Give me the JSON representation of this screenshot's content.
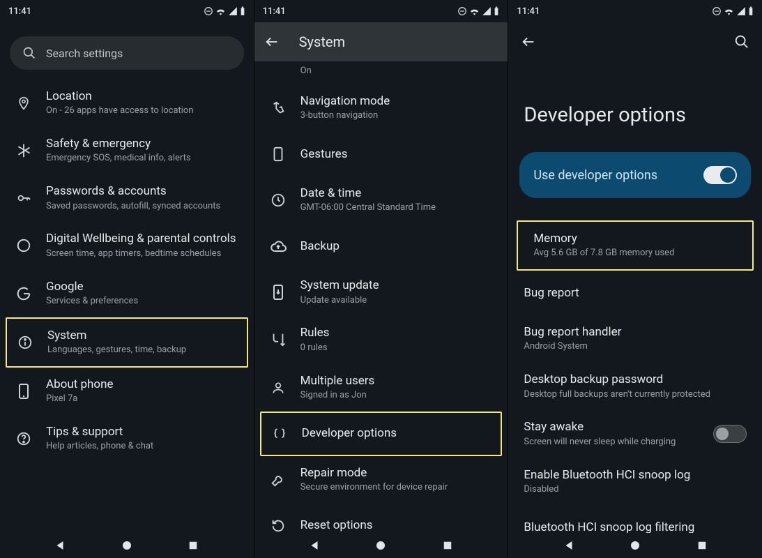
{
  "status": {
    "time": "11:41"
  },
  "screen1": {
    "search_placeholder": "Search settings",
    "items": [
      {
        "name": "location",
        "icon": "pin",
        "title": "Location",
        "subtitle": "On - 26 apps have access to location"
      },
      {
        "name": "safety",
        "icon": "asterisk",
        "title": "Safety & emergency",
        "subtitle": "Emergency SOS, medical info, alerts"
      },
      {
        "name": "passwords",
        "icon": "key",
        "title": "Passwords & accounts",
        "subtitle": "Saved passwords, autofill, synced accounts"
      },
      {
        "name": "wellbeing",
        "icon": "wellbeing",
        "title": "Digital Wellbeing & parental controls",
        "subtitle": "Screen time, app timers, bedtime schedules"
      },
      {
        "name": "google",
        "icon": "google",
        "title": "Google",
        "subtitle": "Services & preferences"
      },
      {
        "name": "system",
        "icon": "info",
        "title": "System",
        "subtitle": "Languages, gestures, time, backup",
        "highlight": true
      },
      {
        "name": "about",
        "icon": "phone",
        "title": "About phone",
        "subtitle": "Pixel 7a"
      },
      {
        "name": "tips",
        "icon": "help",
        "title": "Tips & support",
        "subtitle": "Help articles, phone & chat"
      }
    ]
  },
  "screen2": {
    "title": "System",
    "peek_subtitle": "On",
    "items": [
      {
        "name": "navmode",
        "icon": "swipe",
        "title": "Navigation mode",
        "subtitle": "3-button navigation"
      },
      {
        "name": "gestures",
        "icon": "phone-rect",
        "title": "Gestures"
      },
      {
        "name": "datetime",
        "icon": "clock",
        "title": "Date & time",
        "subtitle": "GMT-06:00 Central Standard Time"
      },
      {
        "name": "backup",
        "icon": "cloud",
        "title": "Backup"
      },
      {
        "name": "update",
        "icon": "phone-down",
        "title": "System update",
        "subtitle": "Update available"
      },
      {
        "name": "rules",
        "icon": "rules",
        "title": "Rules",
        "subtitle": "0 rules"
      },
      {
        "name": "users",
        "icon": "user",
        "title": "Multiple users",
        "subtitle": "Signed in as Jon"
      },
      {
        "name": "devopts",
        "icon": "braces",
        "title": "Developer options",
        "highlight": true
      },
      {
        "name": "repair",
        "icon": "wrench",
        "title": "Repair mode",
        "subtitle": "Secure environment for device repair"
      },
      {
        "name": "reset",
        "icon": "reset",
        "title": "Reset options"
      }
    ]
  },
  "screen3": {
    "title": "Developer options",
    "toggle_label": "Use developer options",
    "toggle_on": true,
    "items": [
      {
        "name": "memory",
        "title": "Memory",
        "subtitle": "Avg 5.6 GB of 7.8 GB memory used",
        "highlight": true
      },
      {
        "name": "bugreport",
        "title": "Bug report"
      },
      {
        "name": "bughandler",
        "title": "Bug report handler",
        "subtitle": "Android System"
      },
      {
        "name": "desktop-backup",
        "title": "Desktop backup password",
        "subtitle": "Desktop full backups aren't currently protected"
      },
      {
        "name": "stay-awake",
        "title": "Stay awake",
        "subtitle": "Screen will never sleep while charging",
        "switch": "off"
      },
      {
        "name": "hci-log",
        "title": "Enable Bluetooth HCI snoop log",
        "subtitle": "Disabled"
      },
      {
        "name": "hci-filter",
        "title": "Bluetooth HCI snoop log filtering"
      }
    ]
  }
}
